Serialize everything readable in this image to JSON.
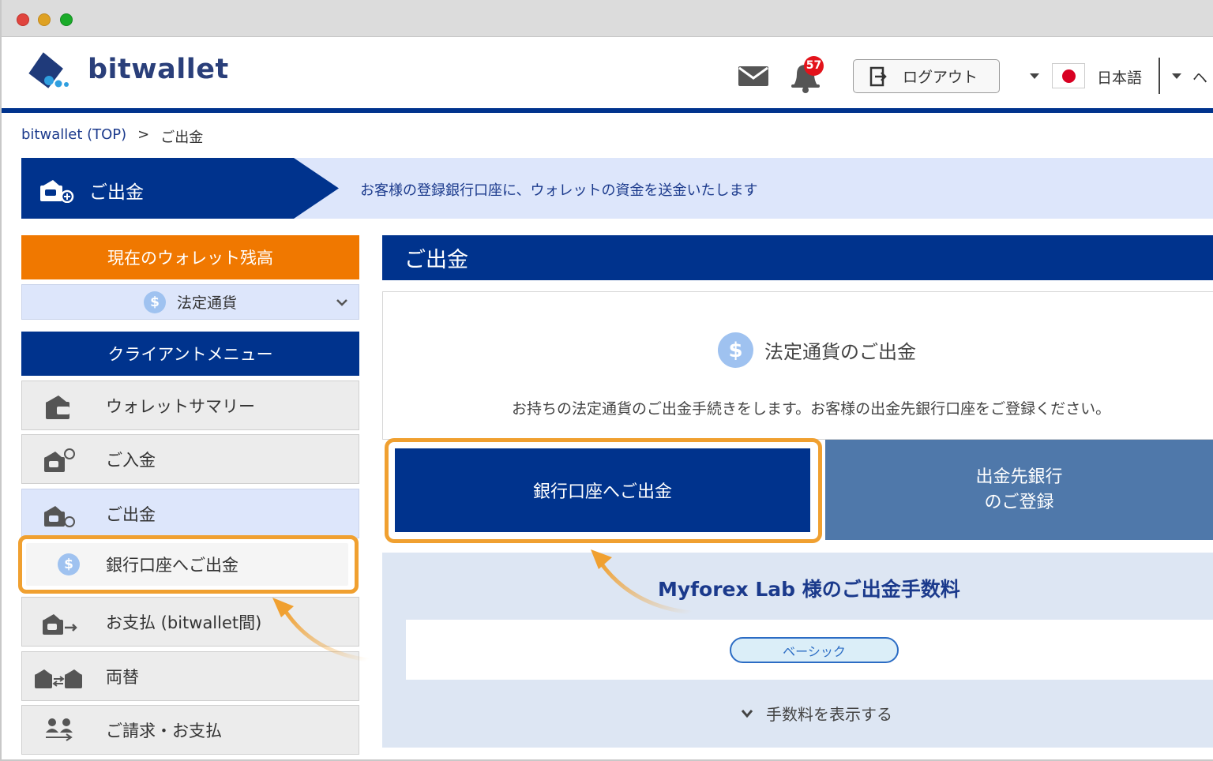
{
  "header": {
    "brand": "bitwallet",
    "notification_count": "57",
    "logout_label": "ログアウト",
    "language": "日本語",
    "cut_off_text": "ヘ"
  },
  "breadcrumb": {
    "home": "bitwallet (TOP)",
    "separator": ">",
    "current": "ご出金"
  },
  "banner": {
    "title": "ご出金",
    "description": "お客様の登録銀行口座に、ウォレットの資金を送金いたします"
  },
  "sidebar": {
    "balance_heading": "現在のウォレット残高",
    "currency_selector": "法定通貨",
    "menu_heading": "クライアントメニュー",
    "items": [
      {
        "label": "ウォレットサマリー",
        "icon": "wallet-icon"
      },
      {
        "label": "ご入金",
        "icon": "wallet-deposit-icon"
      },
      {
        "label": "ご出金",
        "icon": "wallet-withdraw-icon"
      },
      {
        "label": "お支払 (bitwallet間)",
        "icon": "wallet-transfer-icon"
      },
      {
        "label": "両替",
        "icon": "wallet-exchange-icon"
      },
      {
        "label": "ご請求・お支払",
        "icon": "users-billing-icon"
      }
    ],
    "submenu_item": "銀行口座へご出金"
  },
  "main": {
    "heading": "ご出金",
    "section_title": "法定通貨のご出金",
    "section_desc": "お持ちの法定通貨のご出金手続きをします。お客様の出金先銀行口座をご登録ください。",
    "bank_withdraw_button": "銀行口座へご出金",
    "register_button_line1": "出金先銀行",
    "register_button_line2": "のご登録",
    "fee_title": "Myforex Lab 様のご出金手数料",
    "fee_plan": "ベーシック",
    "fee_toggle": "手数料を表示する"
  },
  "colors": {
    "brand_navy": "#00338d",
    "accent_orange": "#f07800",
    "highlight": "#f0a030",
    "secondary_blue": "#4f78aa",
    "light_blue_bg": "#dde6fb"
  }
}
